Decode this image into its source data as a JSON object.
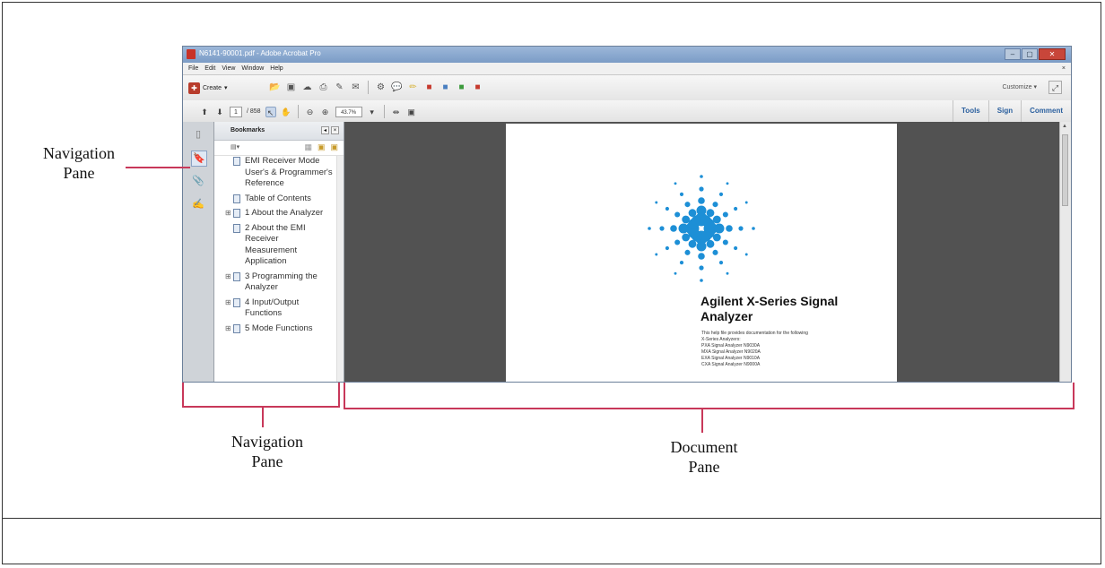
{
  "window": {
    "title": "N6141-90001.pdf - Adobe Acrobat Pro",
    "controls": [
      "–",
      "▢",
      "✕"
    ]
  },
  "menubar": {
    "items": [
      "File",
      "Edit",
      "View",
      "Window",
      "Help"
    ],
    "close_doc": "×"
  },
  "toolbar": {
    "create_label": "Create",
    "customize_label": "Customize"
  },
  "nav_toolbar": {
    "current_page": "1",
    "page_total": "/ 858",
    "zoom": "43.7%"
  },
  "right_tabs": [
    "Tools",
    "Sign",
    "Comment"
  ],
  "nav_pane": {
    "title": "Bookmarks",
    "bookmarks": [
      {
        "label": "EMI Receiver Mode User's & Programmer's Reference",
        "expandable": false
      },
      {
        "label": "Table of Contents",
        "expandable": false
      },
      {
        "label": "1  About the Analyzer",
        "expandable": true
      },
      {
        "label": "2  About the EMI Receiver Measurement Application",
        "expandable": false
      },
      {
        "label": "3  Programming the Analyzer",
        "expandable": true
      },
      {
        "label": "4  Input/Output Functions",
        "expandable": true
      },
      {
        "label": "5  Mode Functions",
        "expandable": true
      }
    ]
  },
  "document": {
    "title": "Agilent X-Series Signal Analyzer",
    "body_lines": [
      "This help file provides documentation for the following",
      "X-Series Analyzers:",
      "PXA Signal Analyzer N9030A",
      "MXA Signal Analyzer N9020A",
      "EXA Signal Analyzer N9010A",
      "CXA Signal Analyzer N9000A"
    ],
    "logo_color": "#1d8fd6"
  },
  "annotations": {
    "nav_left": "Navigation\nPane",
    "nav_bottom": "Navigation\nPane",
    "doc_bottom": "Document\nPane",
    "line_color": "#c8385a"
  }
}
